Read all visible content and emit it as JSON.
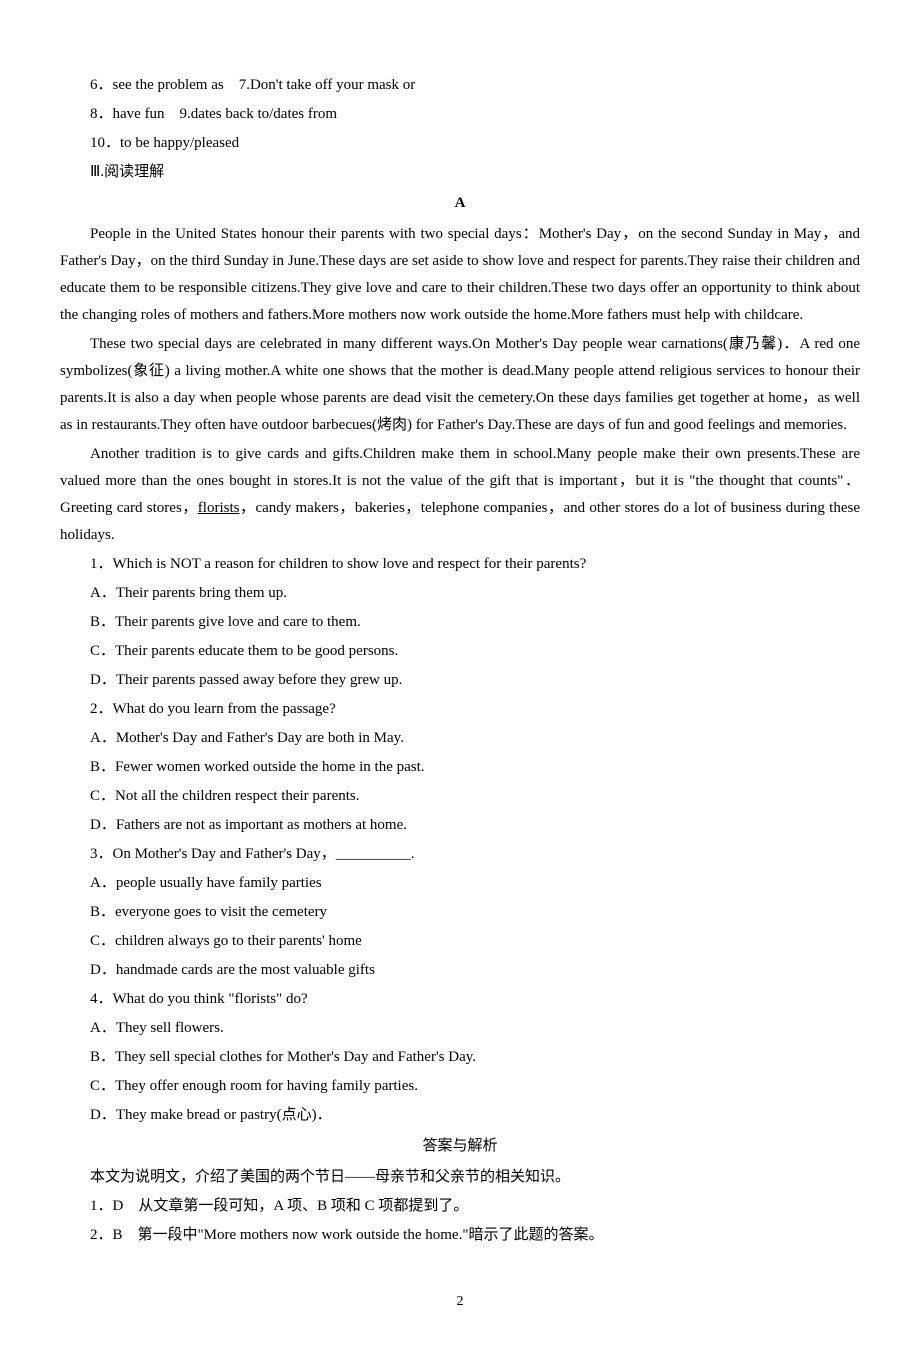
{
  "top_lines": [
    "6．see the problem as　7.Don't take off your mask or",
    "8．have fun　9.dates back to/dates from",
    "10．to be happy/pleased"
  ],
  "section3": "Ⅲ.阅读理解",
  "passage": {
    "label": "A",
    "p1": "People in the United States honour their parents with two special days：Mother's Day，on the second Sunday in May，and Father's Day，on the third Sunday in June.These days are set aside to show love and respect for parents.They raise their children and educate them to be responsible citizens.They give love and care to their children.These two days offer an opportunity to think about the changing roles of mothers and fathers.More mothers now work outside the home.More fathers must help with childcare.",
    "p2": "These two special days are celebrated in many different ways.On Mother's Day people wear carnations(康乃馨)．A red one symbolizes(象征) a living mother.A white one shows that the mother is dead.Many people attend religious services to honour their parents.It is also a day when people whose parents are dead visit the cemetery.On these days families get together at home，as well as in restaurants.They often have outdoor barbecues(烤肉) for Father's Day.These are days of fun and good feelings and memories.",
    "p3_prefix": "Another tradition is to give cards and gifts.Children make them in school.Many people make their own presents.These are valued more than the ones bought in stores.It is not the value of the gift that is important，but it is \"the thought that counts\"．Greeting card stores，",
    "p3_underline": "florists",
    "p3_suffix": "，candy makers，bakeries，telephone companies，and other stores do a lot of business during these holidays."
  },
  "questions": [
    "1．Which is NOT a reason for children to show love and respect for their parents?",
    "A．Their parents bring them up.",
    "B．Their parents give love and care to them.",
    "C．Their parents educate them to be good persons.",
    "D．Their parents passed away before they grew up.",
    "2．What do you learn from the passage?",
    "A．Mother's Day and Father's Day are both in May.",
    "B．Fewer women worked outside the home in the past.",
    "C．Not all the children respect their parents.",
    "D．Fathers are not as important as mothers at home.",
    "3．On Mother's Day and Father's Day，__________.",
    "A．people usually have family parties",
    "B．everyone goes to visit the cemetery",
    "C．children always go to their parents' home",
    "D．hand­made cards are the most valuable gifts",
    "4．What do you think \"florists\" do?",
    "A．They sell flowers.",
    "B．They sell special clothes for Mother's Day and Father's Day.",
    "C．They offer enough room for having family parties.",
    "D．They make bread or pastry(点心)．"
  ],
  "answers": {
    "title": "答案与解析",
    "intro": "本文为说明文，介绍了美国的两个节日——母亲节和父亲节的相关知识。",
    "items": [
      "1．D　从文章第一段可知，A 项、B 项和 C 项都提到了。",
      "2．B　第一段中\"More mothers now work outside the home.\"暗示了此题的答案。"
    ]
  },
  "page_number": "2"
}
